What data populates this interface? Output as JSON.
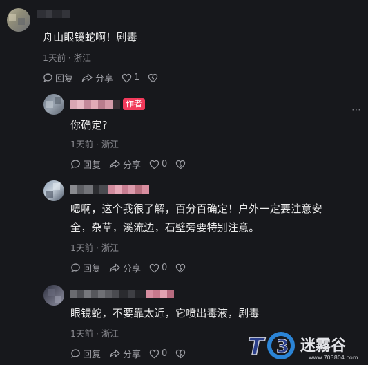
{
  "comments": [
    {
      "text": "舟山眼镜蛇啊！剧毒",
      "meta": "1天前 · 浙江",
      "reply_label": "回复",
      "share_label": "分享",
      "like_count": "1"
    },
    {
      "badge": "作者",
      "text": "你确定?",
      "meta": "1天前 · 浙江",
      "reply_label": "回复",
      "share_label": "分享",
      "like_count": "0"
    },
    {
      "text_line1": "嗯啊，这个我很了解，百分百确定！户外一定要注意安",
      "text_line2": "全，杂草，溪流边，石壁旁要特别注意。",
      "meta": "1天前 · 浙江",
      "reply_label": "回复",
      "share_label": "分享",
      "like_count": "0"
    },
    {
      "text": "眼镜蛇，不要靠太近，它喷出毒液，剧毒",
      "meta": "1天前 · 浙江",
      "reply_label": "回复",
      "share_label": "分享",
      "like_count": "0"
    }
  ],
  "more_glyph": "⋯",
  "watermark": {
    "logo_text": "T03",
    "brand_text": "迷霧谷",
    "url_text": "www.703804.com"
  },
  "colors": {
    "background": "#17181c",
    "author_badge": "#f23a5b",
    "meta_text": "#8b8c92"
  }
}
